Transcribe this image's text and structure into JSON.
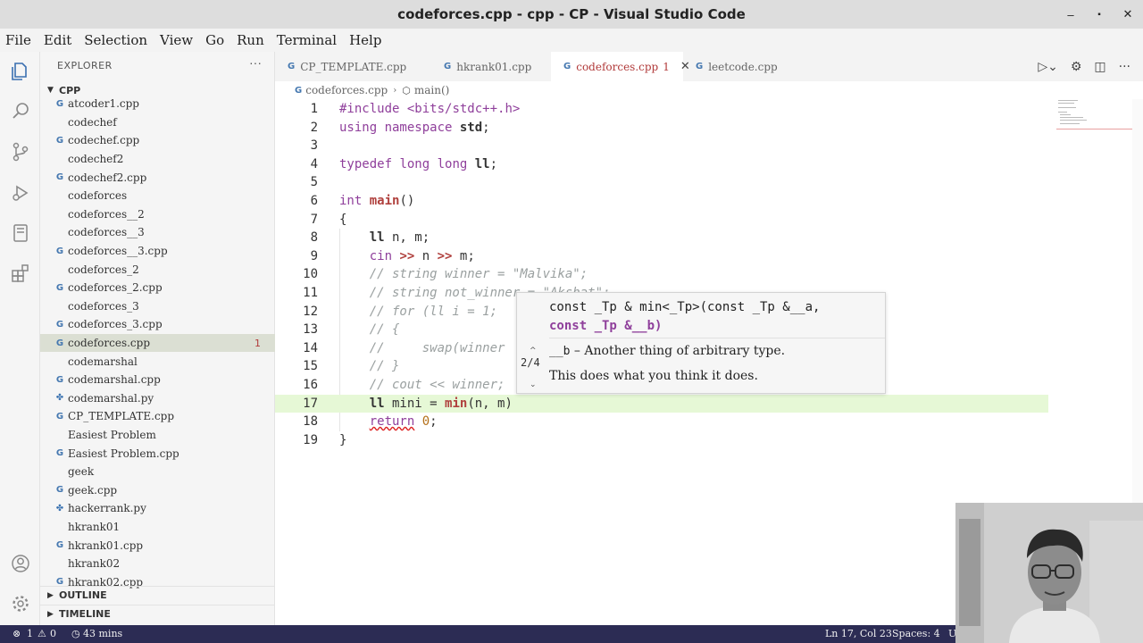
{
  "window": {
    "title": "codeforces.cpp - cpp - CP - Visual Studio Code",
    "minimize": "–",
    "maximize": "▪",
    "close": "✕"
  },
  "menu": [
    "File",
    "Edit",
    "Selection",
    "View",
    "Go",
    "Run",
    "Terminal",
    "Help"
  ],
  "sidebar": {
    "header": "EXPLORER",
    "more": "···",
    "folder": "CPP",
    "files": [
      {
        "name": "atcoder1.cpp",
        "cpp": true
      },
      {
        "name": "codechef",
        "cpp": false
      },
      {
        "name": "codechef.cpp",
        "cpp": true
      },
      {
        "name": "codechef2",
        "cpp": false
      },
      {
        "name": "codechef2.cpp",
        "cpp": true
      },
      {
        "name": "codeforces",
        "cpp": false
      },
      {
        "name": "codeforces__2",
        "cpp": false
      },
      {
        "name": "codeforces__3",
        "cpp": false
      },
      {
        "name": "codeforces__3.cpp",
        "cpp": true
      },
      {
        "name": "codeforces_2",
        "cpp": false
      },
      {
        "name": "codeforces_2.cpp",
        "cpp": true
      },
      {
        "name": "codeforces_3",
        "cpp": false
      },
      {
        "name": "codeforces_3.cpp",
        "cpp": true
      },
      {
        "name": "codeforces.cpp",
        "cpp": true,
        "active": true,
        "badge": "1"
      },
      {
        "name": "codemarshal",
        "cpp": false
      },
      {
        "name": "codemarshal.cpp",
        "cpp": true
      },
      {
        "name": "codemarshal.py",
        "py": true
      },
      {
        "name": "CP_TEMPLATE.cpp",
        "cpp": true
      },
      {
        "name": "Easiest Problem",
        "cpp": false
      },
      {
        "name": "Easiest Problem.cpp",
        "cpp": true
      },
      {
        "name": "geek",
        "cpp": false
      },
      {
        "name": "geek.cpp",
        "cpp": true
      },
      {
        "name": "hackerrank.py",
        "py": true
      },
      {
        "name": "hkrank01",
        "cpp": false
      },
      {
        "name": "hkrank01.cpp",
        "cpp": true
      },
      {
        "name": "hkrank02",
        "cpp": false
      },
      {
        "name": "hkrank02.cpp",
        "cpp": true
      }
    ],
    "outline": "OUTLINE",
    "timeline": "TIMELINE"
  },
  "tabs": [
    {
      "label": "CP_TEMPLATE.cpp"
    },
    {
      "label": "hkrank01.cpp"
    },
    {
      "label": "codeforces.cpp",
      "active": true,
      "problems": "1"
    },
    {
      "label": "leetcode.cpp"
    }
  ],
  "breadcrumb": {
    "file": "codeforces.cpp",
    "symbol": "main()"
  },
  "editor": {
    "lines": [
      {
        "n": "1"
      },
      {
        "n": "2"
      },
      {
        "n": "3"
      },
      {
        "n": "4"
      },
      {
        "n": "5"
      },
      {
        "n": "6"
      },
      {
        "n": "7"
      },
      {
        "n": "8"
      },
      {
        "n": "9"
      },
      {
        "n": "10"
      },
      {
        "n": "11"
      },
      {
        "n": "12"
      },
      {
        "n": "13"
      },
      {
        "n": "14"
      },
      {
        "n": "15"
      },
      {
        "n": "16"
      },
      {
        "n": "17"
      },
      {
        "n": "18"
      },
      {
        "n": "19"
      }
    ],
    "current_line": 17
  },
  "signature_help": {
    "signature_line1": "const _Tp & min<_Tp>(const _Tp &__a,",
    "signature_line2": "const _Tp &__b)",
    "counter": "2/4",
    "param": "__b",
    "param_doc": " – Another thing of arbitrary type.",
    "doc": "This does what you think it does."
  },
  "statusbar": {
    "errors": "1",
    "warnings": "0",
    "timer": "43 mins",
    "position": "Ln 17, Col 23",
    "spaces": "Spaces: 4",
    "encoding": "U"
  },
  "colors": {
    "statusbar": "#2c2c54",
    "keyword": "#8f3f9b",
    "function": "#b0413e",
    "comment": "#9aa0a0",
    "current_line": "#e6f8d6"
  }
}
